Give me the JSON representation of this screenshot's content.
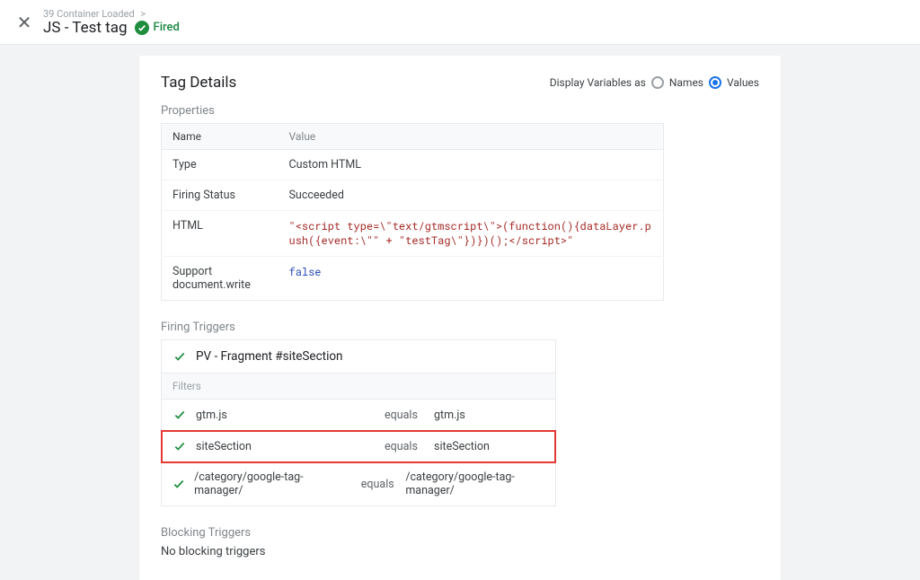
{
  "topbar": {
    "breadcrumb_event_num": "39",
    "breadcrumb_event_name": "Container Loaded",
    "tag_title": "JS - Test tag",
    "fired_label": "Fired"
  },
  "card": {
    "title": "Tag Details",
    "display_label": "Display Variables as",
    "radio_names": "Names",
    "radio_values": "Values"
  },
  "properties": {
    "section_label": "Properties",
    "col_name": "Name",
    "col_value": "Value",
    "rows": [
      {
        "name": "Type",
        "value": "Custom HTML"
      },
      {
        "name": "Firing Status",
        "value": "Succeeded"
      },
      {
        "name": "HTML",
        "value": "\"<script type=\\\"text/gtmscript\\\">(function(){dataLayer.push({event:\\\"\" + \"testTag\\\"})})();</script>\""
      },
      {
        "name": "Support document.write",
        "value": "false"
      }
    ]
  },
  "firing": {
    "section_label": "Firing Triggers",
    "trigger_name": "PV - Fragment #siteSection",
    "filters_label": "Filters",
    "op_label": "equals",
    "filters": [
      {
        "v1": "gtm.js",
        "v2": "gtm.js"
      },
      {
        "v1": "siteSection",
        "v2": "siteSection"
      },
      {
        "v1": "/category/google-tag-manager/",
        "v2": "/category/google-tag-manager/"
      }
    ]
  },
  "blocking": {
    "section_label": "Blocking Triggers",
    "none_text": "No blocking triggers"
  }
}
